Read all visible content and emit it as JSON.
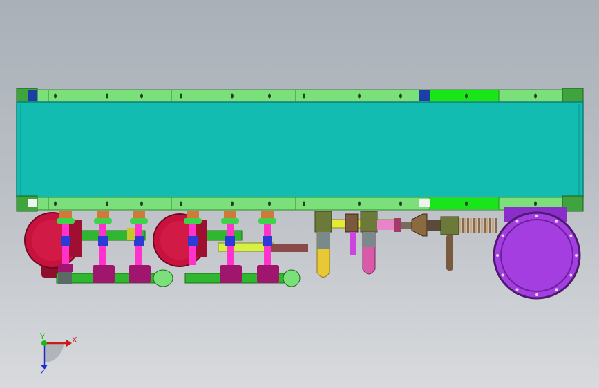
{
  "viewport": {
    "background_top": "#a9b0b7",
    "background_bottom": "#d8dadd"
  },
  "colors": {
    "tank": "#13bcb0",
    "frame": "#7ce07a",
    "frame_dark": "#2e8a2c",
    "frame_bright": "#19e619",
    "pump": "#c8123e",
    "pipe_green": "#2fb82f",
    "valve_magenta": "#a0166e",
    "stem_pink": "#ff33cc",
    "flange_green": "#3fd24a",
    "valve_blue": "#2d3bd6",
    "yellow": "#e8e836",
    "olive": "#6b7a3a",
    "brown": "#7a5a3e",
    "purple": "#a53ee0",
    "pink_pipe": "#e884c8"
  },
  "triad": {
    "x_label": "X",
    "y_label": "Y",
    "z_label": "Z"
  }
}
